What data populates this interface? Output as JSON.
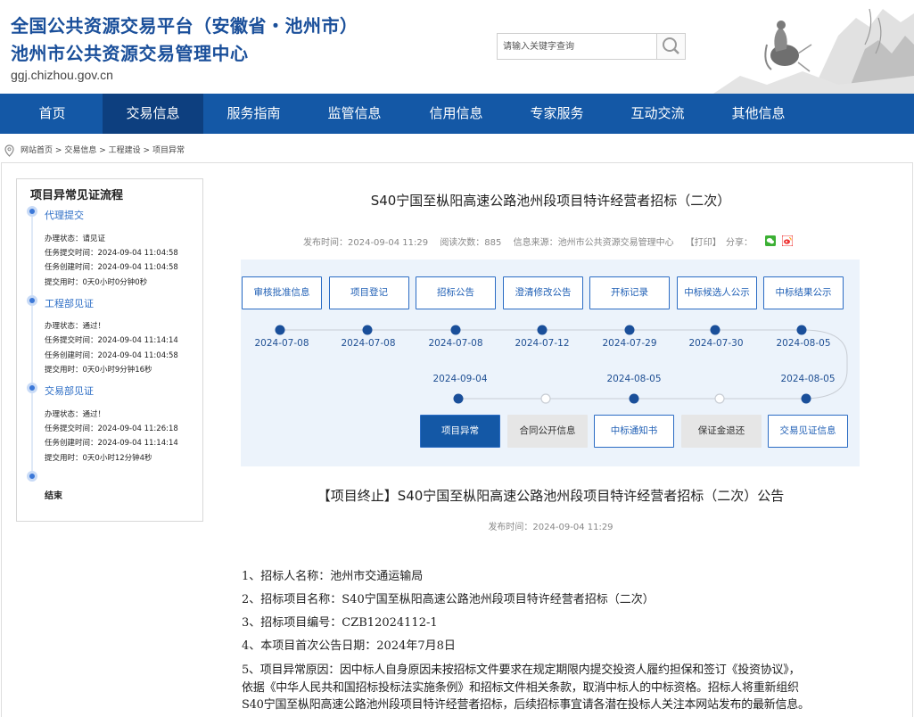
{
  "header": {
    "title_line1": "全国公共资源交易平台（安徽省・池州市）",
    "title_line2": "池州市公共资源交易管理中心",
    "domain": "ggj.chizhou.gov.cn",
    "search_placeholder": "请输入关键字查询",
    "brand_color": "#1458a6"
  },
  "nav": {
    "items": [
      "首页",
      "交易信息",
      "服务指南",
      "监管信息",
      "信用信息",
      "专家服务",
      "互动交流",
      "其他信息"
    ],
    "active": "交易信息"
  },
  "breadcrumb": {
    "items": [
      "网站首页",
      "交易信息",
      "工程建设",
      "项目异常"
    ],
    "separator": ">"
  },
  "sidebar": {
    "title": "项目异常见证流程",
    "steps": [
      {
        "name": "代理提交",
        "lines": [
          "办理状态：请见证",
          "任务提交时间：2024-09-04 11:04:58",
          "任务创建时间：2024-09-04 11:04:58",
          "提交用时：0天0小时0分钟0秒"
        ]
      },
      {
        "name": "工程部见证",
        "lines": [
          "办理状态：通过！",
          "任务提交时间：2024-09-04 11:14:14",
          "任务创建时间：2024-09-04 11:04:58",
          "提交用时：0天0小时9分钟16秒"
        ]
      },
      {
        "name": "交易部见证",
        "lines": [
          "办理状态：通过！",
          "任务提交时间：2024-09-04 11:26:18",
          "任务创建时间：2024-09-04 11:14:14",
          "提交用时：0天0小时12分钟4秒"
        ]
      }
    ],
    "end_label": "结束"
  },
  "article": {
    "title": "S40宁国至枞阳高速公路池州段项目特许经营者招标（二次）",
    "publish_time": "发布时间：2024-09-04 11:29",
    "views": "阅读次数：885",
    "source": "信息来源：池州市公共资源交易管理中心",
    "print": "【打印】",
    "share": "分享："
  },
  "flow": {
    "top_buttons": [
      "审核批准信息",
      "项目登记",
      "招标公告",
      "澄清修改公告",
      "开标记录",
      "中标候选人公示",
      "中标结果公示"
    ],
    "top_dates": [
      "2024-07-08",
      "2024-07-08",
      "2024-07-08",
      "2024-07-12",
      "2024-07-29",
      "2024-07-30",
      "2024-08-05"
    ],
    "bottom_buttons": [
      "项目异常",
      "合同公开信息",
      "中标通知书",
      "保证金退还",
      "交易见证信息"
    ],
    "bottom_dates": [
      "2024-09-04",
      "",
      "2024-08-05",
      "",
      "2024-08-05"
    ],
    "bottom_states": [
      "active",
      "gray",
      "normal",
      "gray",
      "normal"
    ]
  },
  "notice": {
    "title": "【项目终止】S40宁国至枞阳高速公路池州段项目特许经营者招标（二次）公告",
    "time": "发布时间：2024-09-04 11:29",
    "lines": [
      "1、招标人名称：池州市交通运输局",
      "2、招标项目名称：S40宁国至枞阳高速公路池州段项目特许经营者招标（二次）",
      "3、招标项目编号：CZB12024112-1",
      "4、本项目首次公告日期：2024年7月8日",
      "5、项目异常原因：因中标人自身原因未按招标文件要求在规定期限内提交投资人履约担保和签订《投资协议》，",
      "依据《中华人民共和国招标投标法实施条例》和招标文件相关条款，取消中标人的中标资格。招标人将重新组织",
      "S40宁国至枞阳高速公路池州段项目特许经营者招标，后续招标事宜请各潜在投标人关注本网站发布的最新信息。"
    ]
  }
}
